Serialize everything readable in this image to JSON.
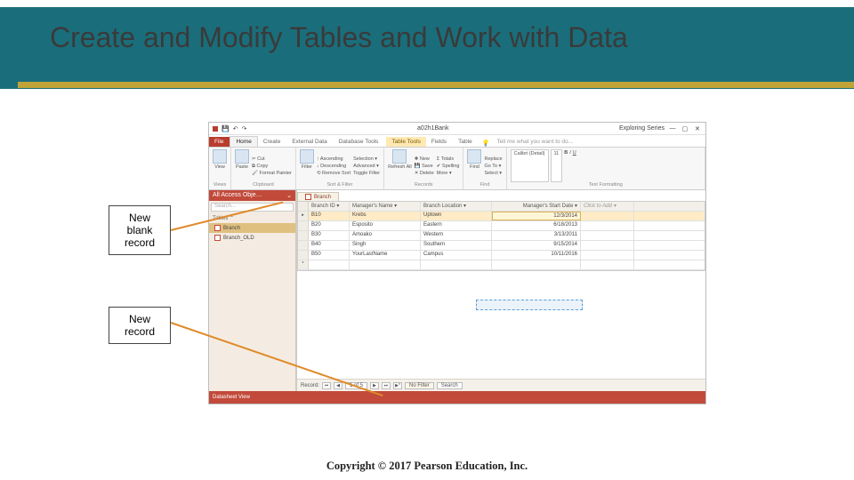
{
  "slide": {
    "title": "Create and Modify Tables and Work with Data",
    "callout1": "New blank record",
    "callout2": "New record",
    "copyright": "Copyright © 2017 Pearson Education, Inc."
  },
  "access": {
    "titlebar": {
      "title": "a02h1Bank",
      "right_label": "Exploring Series"
    },
    "tabs": {
      "items": [
        "File",
        "Home",
        "Create",
        "External Data",
        "Database Tools"
      ],
      "context_header": "Table Tools",
      "context_tabs": [
        "Fields",
        "Table"
      ],
      "tell_me": "Tell me what you want to do..."
    },
    "ribbon": {
      "views": {
        "btn": "View",
        "label": "Views"
      },
      "clipboard": {
        "paste": "Paste",
        "cut": "Cut",
        "copy": "Copy",
        "fmt": "Format Painter",
        "label": "Clipboard"
      },
      "sort": {
        "filter": "Filter",
        "asc": "Ascending",
        "desc": "Descending",
        "rem": "Remove Sort",
        "sel": "Selection ▾",
        "adv": "Advanced ▾",
        "tog": "Toggle Filter",
        "label": "Sort & Filter"
      },
      "records": {
        "refresh": "Refresh All",
        "new": "New",
        "save": "Save",
        "delete": "Delete",
        "totals": "Totals",
        "spelling": "Spelling",
        "more": "More ▾",
        "label": "Records"
      },
      "find": {
        "find": "Find",
        "replace": "Replace",
        "gotof": "Go To ▾",
        "select": "Select ▾",
        "label": "Find"
      },
      "text": {
        "font": "Calibri (Detail)",
        "size": "11",
        "label": "Text Formatting"
      }
    },
    "nav": {
      "header": "All Access Obje…",
      "search_ph": "Search...",
      "section": "Tables",
      "items": [
        "Branch",
        "Branch_OLD"
      ]
    },
    "doctab": "Branch",
    "table": {
      "headers": [
        "Branch ID",
        "Manager's Name",
        "Branch Location",
        "Manager's Start Date",
        "Click to Add"
      ],
      "rows": [
        {
          "id": "B10",
          "name": "Krebs",
          "loc": "Uptown",
          "date": "12/3/2014"
        },
        {
          "id": "B20",
          "name": "Esposito",
          "loc": "Eastern",
          "date": "6/18/2013"
        },
        {
          "id": "B30",
          "name": "Amoako",
          "loc": "Western",
          "date": "3/13/2011"
        },
        {
          "id": "B40",
          "name": "Singh",
          "loc": "Southern",
          "date": "9/15/2014"
        },
        {
          "id": "B50",
          "name": "YourLastName",
          "loc": "Campus",
          "date": "10/11/2016"
        }
      ],
      "new_marker": "*"
    },
    "recordnav": {
      "label": "Record:",
      "pos": "1 of 5",
      "nofilter": "No Filter",
      "search": "Search"
    },
    "status": "Datasheet View"
  }
}
